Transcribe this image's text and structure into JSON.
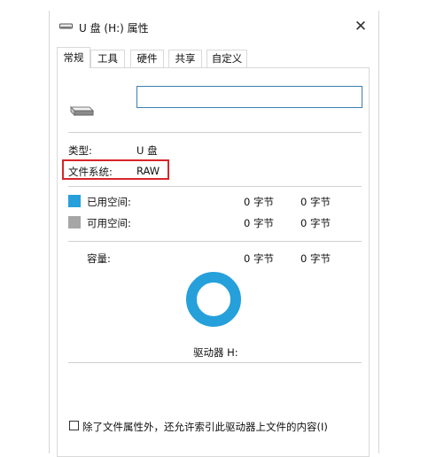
{
  "window": {
    "title": "U 盘 (H:) 属性",
    "close_glyph": "✕"
  },
  "tabs": [
    {
      "label": "常规",
      "active": true
    },
    {
      "label": "工具",
      "active": false
    },
    {
      "label": "硬件",
      "active": false
    },
    {
      "label": "共享",
      "active": false
    },
    {
      "label": "自定义",
      "active": false
    }
  ],
  "general": {
    "name_value": "",
    "type_label": "类型:",
    "type_value": "U 盘",
    "fs_label": "文件系统:",
    "fs_value": "RAW",
    "used_label": "已用空间:",
    "used_bytes": "0 字节",
    "used_size": "0 字节",
    "free_label": "可用空间:",
    "free_bytes": "0 字节",
    "free_size": "0 字节",
    "capacity_label": "容量:",
    "capacity_bytes": "0 字节",
    "capacity_size": "0 字节",
    "drive_label": "驱动器 H:",
    "index_checkbox_label": "除了文件属性外，还允许索引此驱动器上文件的内容(I)",
    "index_checked": false
  },
  "colors": {
    "used": "#26a0da",
    "free": "#a6a6a6",
    "highlight_box": "#d6262b",
    "input_border": "#3c7fb1"
  },
  "icons": {
    "title": "usb-drive-icon",
    "drive": "usb-drive-icon"
  }
}
